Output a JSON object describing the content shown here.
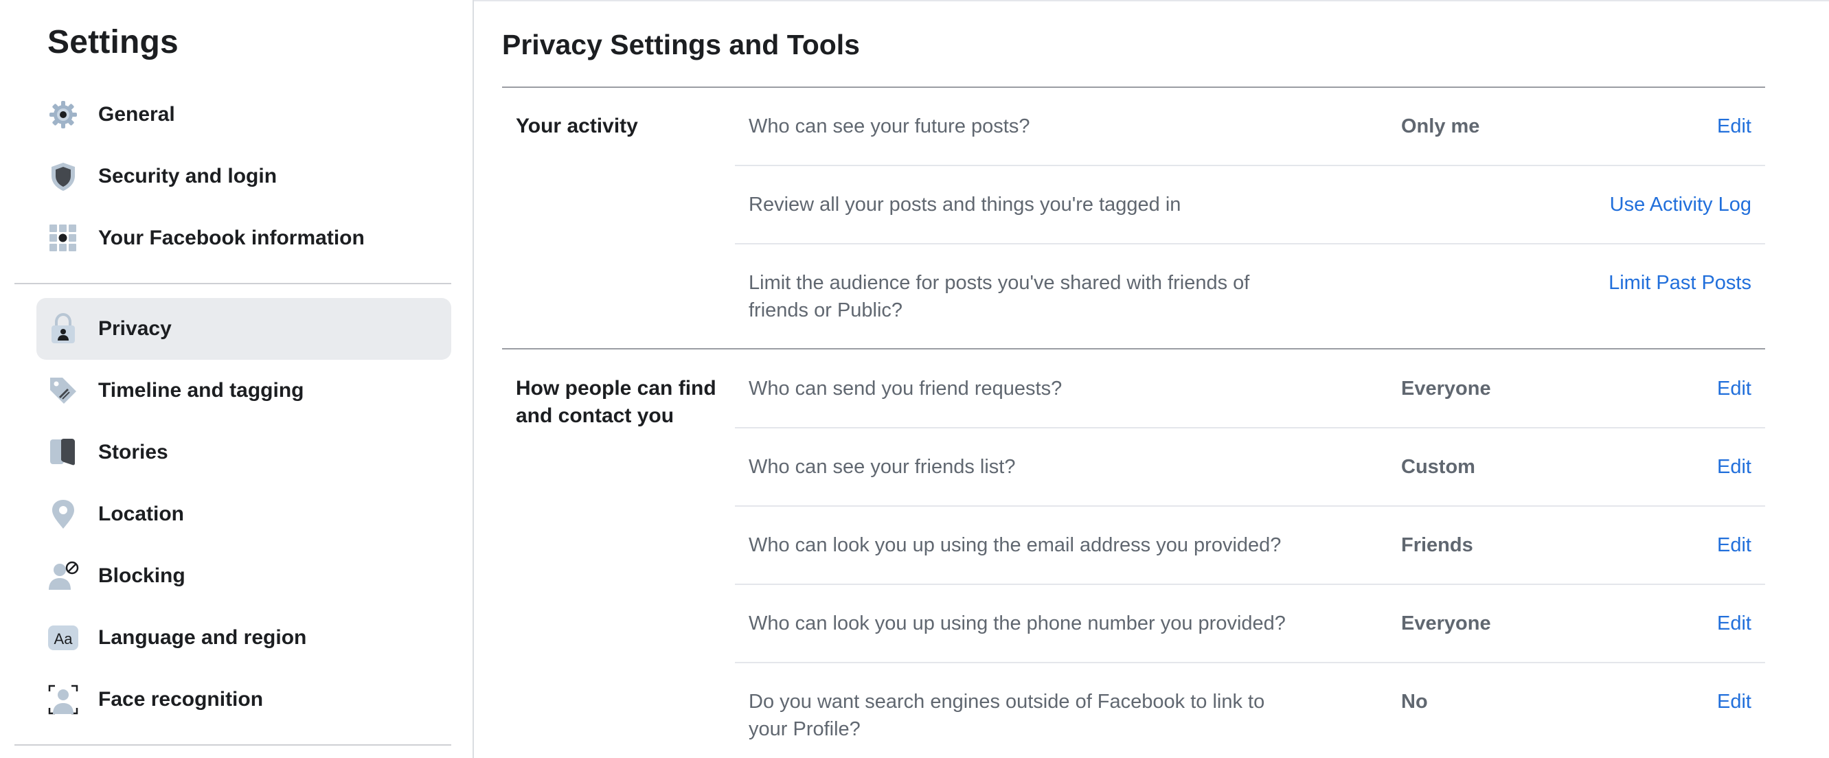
{
  "sidebar": {
    "title": "Settings",
    "items": [
      {
        "label": "General",
        "icon": "gear-icon"
      },
      {
        "label": "Security and login",
        "icon": "shield-icon"
      },
      {
        "label": "Your Facebook information",
        "icon": "grid-icon"
      },
      {
        "label": "Privacy",
        "icon": "lock-icon",
        "active": true
      },
      {
        "label": "Timeline and tagging",
        "icon": "tag-icon"
      },
      {
        "label": "Stories",
        "icon": "book-icon"
      },
      {
        "label": "Location",
        "icon": "map-pin-icon"
      },
      {
        "label": "Blocking",
        "icon": "blocked-user-icon"
      },
      {
        "label": "Language and region",
        "icon": "font-aa-icon"
      },
      {
        "label": "Face recognition",
        "icon": "face-scan-icon"
      }
    ]
  },
  "main": {
    "title": "Privacy Settings and Tools",
    "sections": [
      {
        "label": "Your activity",
        "rows": [
          {
            "question": "Who can see your future posts?",
            "value": "Only me",
            "action": "Edit"
          },
          {
            "question": "Review all your posts and things you're tagged in",
            "value": "",
            "action": "Use Activity Log"
          },
          {
            "question": "Limit the audience for posts you've shared with friends of friends or Public?",
            "value": "",
            "action": "Limit Past Posts"
          }
        ]
      },
      {
        "label": "How people can find and contact you",
        "rows": [
          {
            "question": "Who can send you friend requests?",
            "value": "Everyone",
            "action": "Edit"
          },
          {
            "question": "Who can see your friends list?",
            "value": "Custom",
            "action": "Edit"
          },
          {
            "question": "Who can look you up using the email address you provided?",
            "value": "Friends",
            "action": "Edit"
          },
          {
            "question": "Who can look you up using the phone number you provided?",
            "value": "Everyone",
            "action": "Edit"
          },
          {
            "question": "Do you want search engines outside of Facebook to link to your Profile?",
            "value": "No",
            "action": "Edit"
          }
        ]
      }
    ]
  },
  "colors": {
    "link": "#216fdb",
    "active_bg": "#e9ebee",
    "muted_text": "#606770"
  }
}
